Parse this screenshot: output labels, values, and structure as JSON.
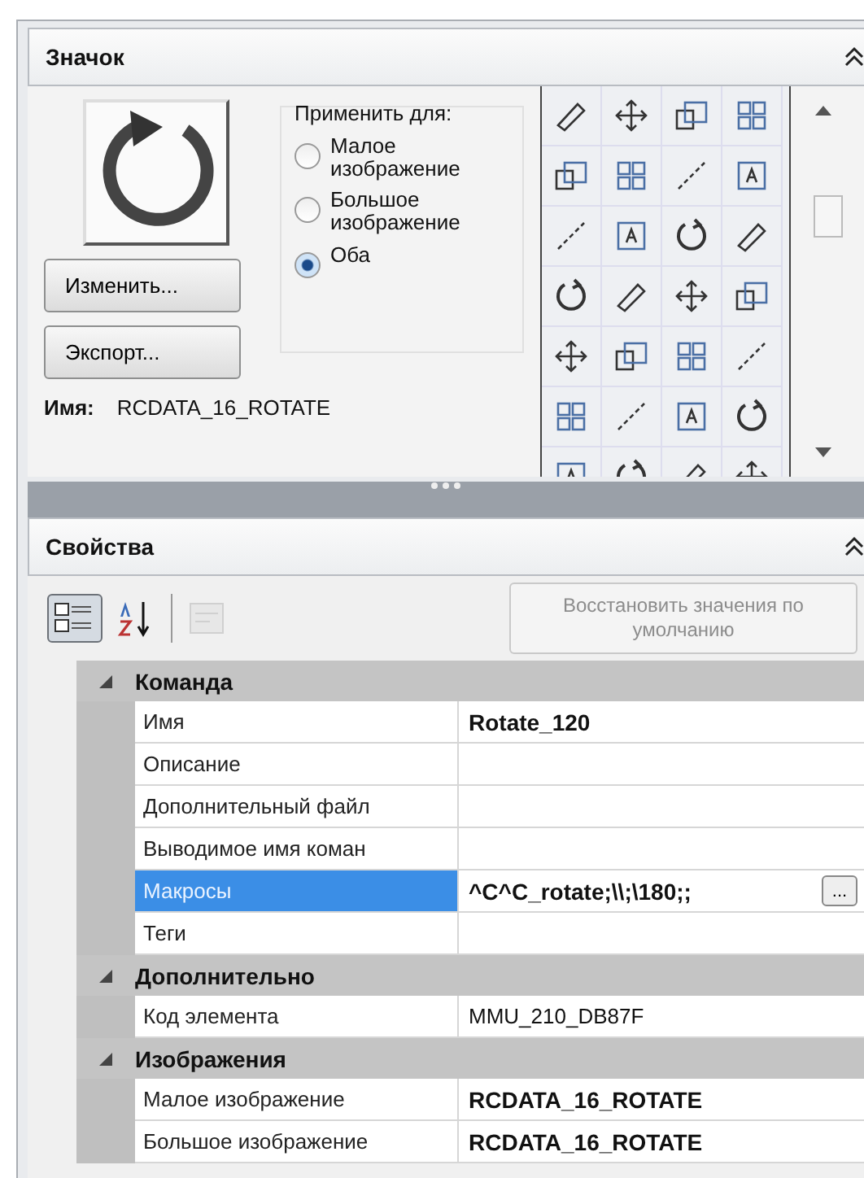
{
  "icon_panel": {
    "title": "Значок",
    "apply": {
      "label": "Применить для:",
      "options": [
        {
          "label": "Малое изображение",
          "selected": false
        },
        {
          "label": "Большое изображение",
          "selected": false
        },
        {
          "label": "Оба",
          "selected": true
        }
      ]
    },
    "buttons": [
      "Изменить...",
      "Экспорт..."
    ],
    "name_label": "Имя:",
    "name_value": "RCDATA_16_ROTATE"
  },
  "properties": {
    "title": "Свойства",
    "toolbar": [
      {
        "kind": "categorized",
        "selected": true,
        "disabled": false
      },
      {
        "kind": "alphabetical",
        "selected": false,
        "disabled": false
      },
      {
        "kind": "pages",
        "selected": false,
        "disabled": true
      }
    ],
    "reset_button": {
      "label": "Восстановить значения по умолчанию",
      "disabled": true
    },
    "groups": [
      {
        "title": "Команда",
        "expanded": true,
        "rows": [
          {
            "name": "Имя",
            "value": "Rotate_120",
            "bold": true,
            "selected": false
          },
          {
            "name": "Описание",
            "selected": false
          },
          {
            "name": "Дополнительный файл",
            "selected": false
          },
          {
            "name": "Выводимое имя коман",
            "selected": false
          },
          {
            "name": "Макросы",
            "value": "^C^C_rotate;\\\\;\\180;;",
            "bold": true,
            "selected": true,
            "has_button": true,
            "button_label": "..."
          },
          {
            "name": "Теги",
            "selected": false
          }
        ]
      },
      {
        "title": "Дополнительно",
        "expanded": true,
        "rows": [
          {
            "name": "Код элемента",
            "value": "MMU_210_DB87F",
            "bold": false,
            "selected": false
          }
        ]
      },
      {
        "title": "Изображения",
        "expanded": true,
        "rows": [
          {
            "name": "Малое изображение",
            "value": "RCDATA_16_ROTATE",
            "bold": true,
            "selected": false
          },
          {
            "name": "Большое изображение",
            "value": "RCDATA_16_ROTATE",
            "bold": true,
            "selected": false
          }
        ]
      }
    ]
  }
}
